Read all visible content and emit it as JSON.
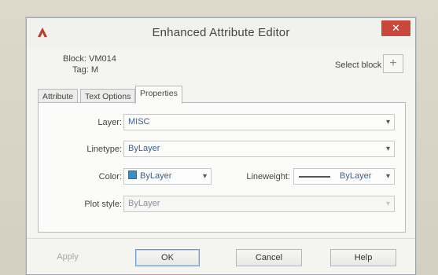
{
  "window": {
    "title": "Enhanced Attribute Editor",
    "close_glyph": "✕",
    "app_icon": "autocad-logo-icon"
  },
  "info": {
    "block_label": "Block: VM014",
    "tag_label": "Tag: M",
    "select_block_label": "Select block",
    "select_block_icon": "plus-pick-icon"
  },
  "tabs": [
    {
      "label": "Attribute",
      "active": false
    },
    {
      "label": "Text Options",
      "active": false
    },
    {
      "label": "Properties",
      "active": true
    }
  ],
  "properties": {
    "layer_label": "Layer:",
    "layer_value": "MISC",
    "linetype_label": "Linetype:",
    "linetype_value": "ByLayer",
    "color_label": "Color:",
    "color_value": "ByLayer",
    "color_swatch": "#3a8fc2",
    "lineweight_label": "Lineweight:",
    "lineweight_value": "ByLayer",
    "plotstyle_label": "Plot style:",
    "plotstyle_value": "ByLayer"
  },
  "buttons": {
    "apply": "Apply",
    "ok": "OK",
    "cancel": "Cancel",
    "help": "Help"
  },
  "colors": {
    "close_button": "#c9483b",
    "app_icon": "#c0392b"
  }
}
